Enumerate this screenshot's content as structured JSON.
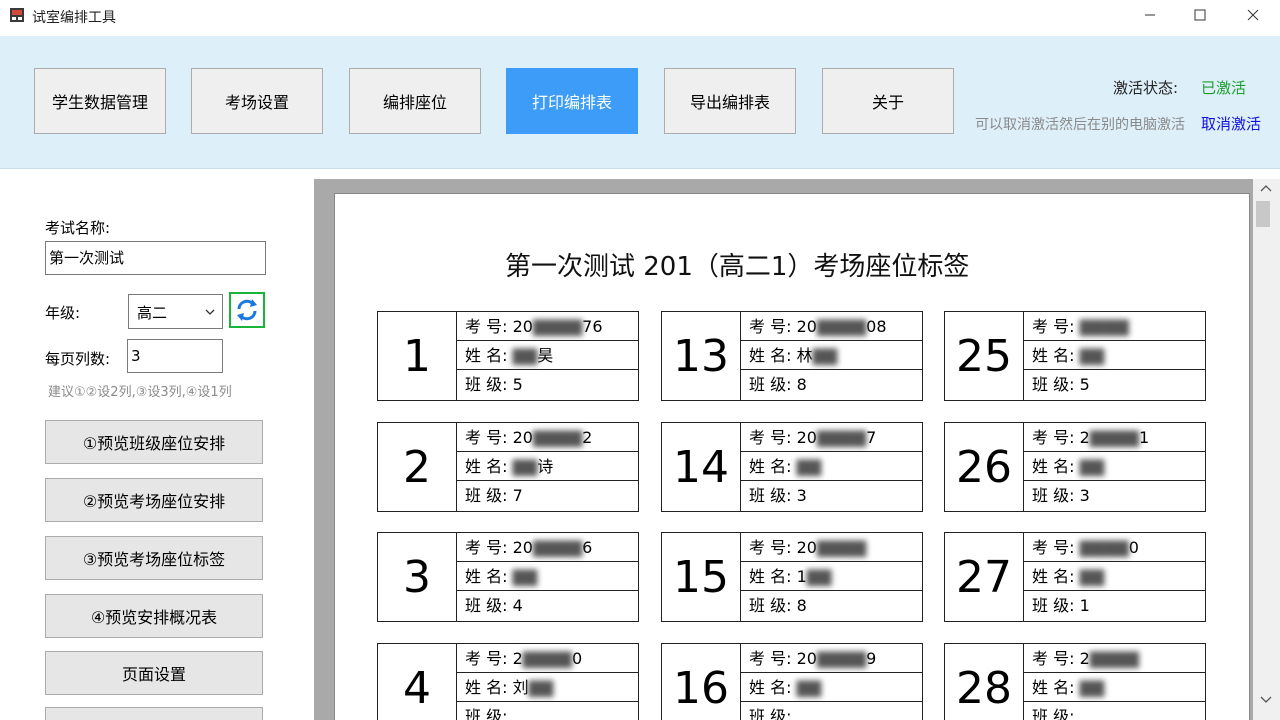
{
  "window": {
    "title": "试室编排工具",
    "controls": {
      "minimize": "—",
      "maximize": "☐",
      "close": "✕"
    }
  },
  "toolbar": {
    "buttons": [
      "学生数据管理",
      "考场设置",
      "编排座位",
      "打印编排表",
      "导出编排表",
      "关于"
    ],
    "active": "打印编排表"
  },
  "activation": {
    "label": "激活状态:",
    "status": "已激活",
    "status_color": "#1d9d2f",
    "hint": "可以取消激活然后在别的电脑激活",
    "cancel": "取消激活",
    "cancel_color": "#1010e0"
  },
  "left": {
    "exam_name_label": "考试名称:",
    "exam_name_value": "第一次测试",
    "grade_label": "年级:",
    "grade_value": "高二",
    "cols_label": "每页列数:",
    "cols_value": "3",
    "hint": "建议①②设2列,③设3列,④设1列",
    "buttons": [
      "①预览班级座位安排",
      "②预览考场座位安排",
      "③预览考场座位标签",
      "④预览安排概况表",
      "页面设置"
    ]
  },
  "document": {
    "title": "第一次测试 201（高二1）考场座位标签",
    "cards": [
      {
        "num": "1",
        "id_prefix": "20",
        "id_suffix": "76",
        "name_prefix": "",
        "name_suffix": "昊",
        "class": "5"
      },
      {
        "num": "13",
        "id_prefix": "20",
        "id_suffix": "08",
        "name_prefix": "林",
        "name_suffix": "",
        "class": "8"
      },
      {
        "num": "25",
        "id_prefix": "",
        "id_suffix": "",
        "name_prefix": "",
        "name_suffix": "",
        "class": "5"
      },
      {
        "num": "2",
        "id_prefix": "20",
        "id_suffix": "2",
        "name_prefix": "",
        "name_suffix": "诗",
        "class": "7"
      },
      {
        "num": "14",
        "id_prefix": "20",
        "id_suffix": "7",
        "name_prefix": "",
        "name_suffix": "",
        "class": "3"
      },
      {
        "num": "26",
        "id_prefix": "2",
        "id_suffix": "1",
        "name_prefix": "",
        "name_suffix": "",
        "class": "3"
      },
      {
        "num": "3",
        "id_prefix": "20",
        "id_suffix": "6",
        "name_prefix": "",
        "name_suffix": "",
        "class": "4"
      },
      {
        "num": "15",
        "id_prefix": "20",
        "id_suffix": "",
        "name_prefix": "1",
        "name_suffix": "",
        "class": "8"
      },
      {
        "num": "27",
        "id_prefix": "",
        "id_suffix": "0",
        "name_prefix": "",
        "name_suffix": "",
        "class": "1"
      },
      {
        "num": "4",
        "id_prefix": "2",
        "id_suffix": "0",
        "name_prefix": "刘",
        "name_suffix": "",
        "class": ""
      },
      {
        "num": "16",
        "id_prefix": "20",
        "id_suffix": "9",
        "name_prefix": "",
        "name_suffix": "",
        "class": ""
      },
      {
        "num": "28",
        "id_prefix": "2",
        "id_suffix": "",
        "name_prefix": "",
        "name_suffix": "",
        "class": ""
      }
    ],
    "field_labels": {
      "id": "考 号:",
      "name": "姓 名:",
      "class": "班 级:"
    }
  }
}
